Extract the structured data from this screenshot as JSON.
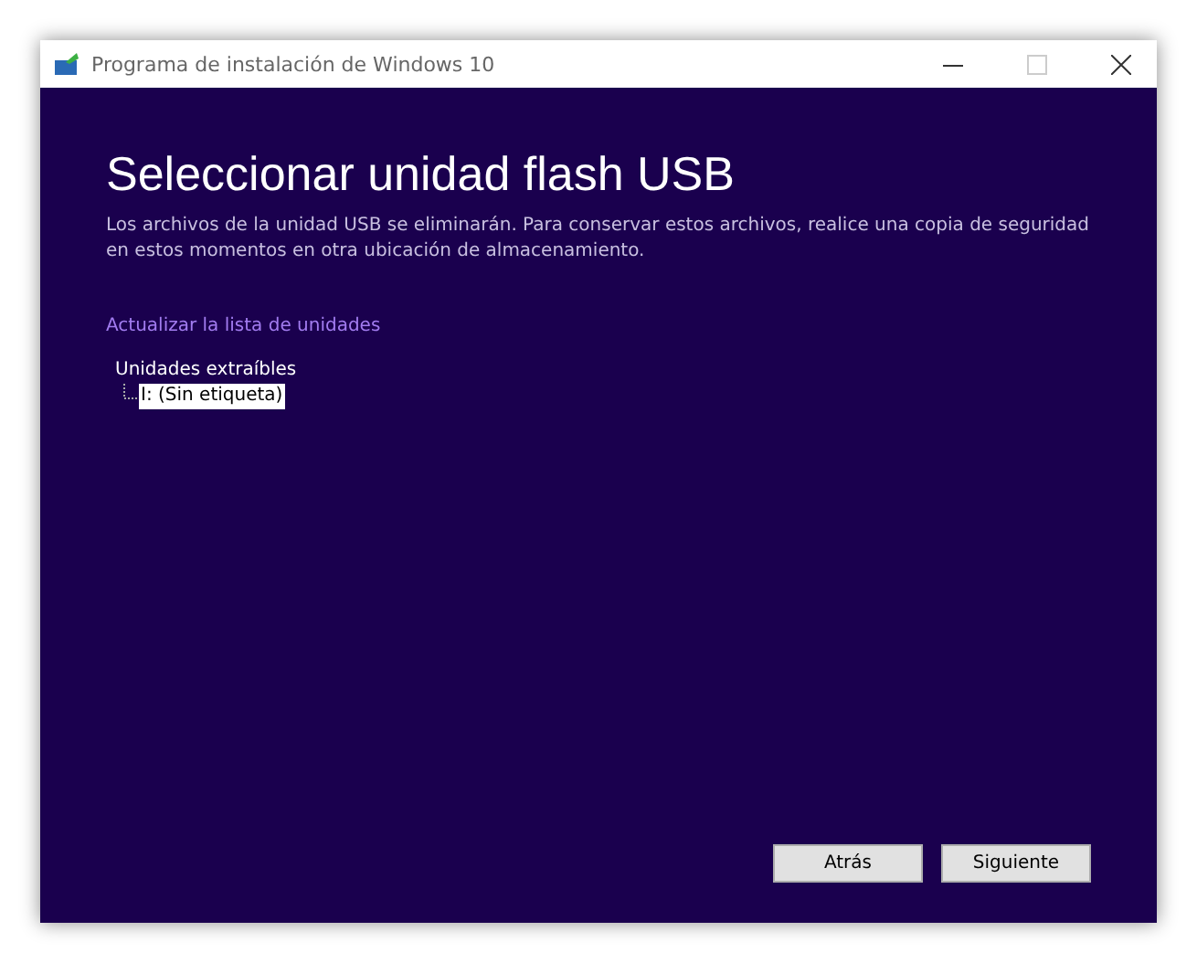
{
  "window": {
    "title": "Programa de instalación de Windows 10"
  },
  "heading": "Seleccionar unidad flash USB",
  "description": "Los archivos de la unidad USB se eliminarán. Para conservar estos archivos, realice una copia de seguridad en estos momentos en otra ubicación de almacenamiento.",
  "refresh_link": "Actualizar la lista de unidades",
  "tree": [
    {
      "label": "Unidades extraíbles",
      "selected": false,
      "children": [
        {
          "label": "I: (Sin etiqueta)",
          "selected": true
        }
      ]
    }
  ],
  "buttons": [
    "Atrás",
    "Siguiente"
  ]
}
